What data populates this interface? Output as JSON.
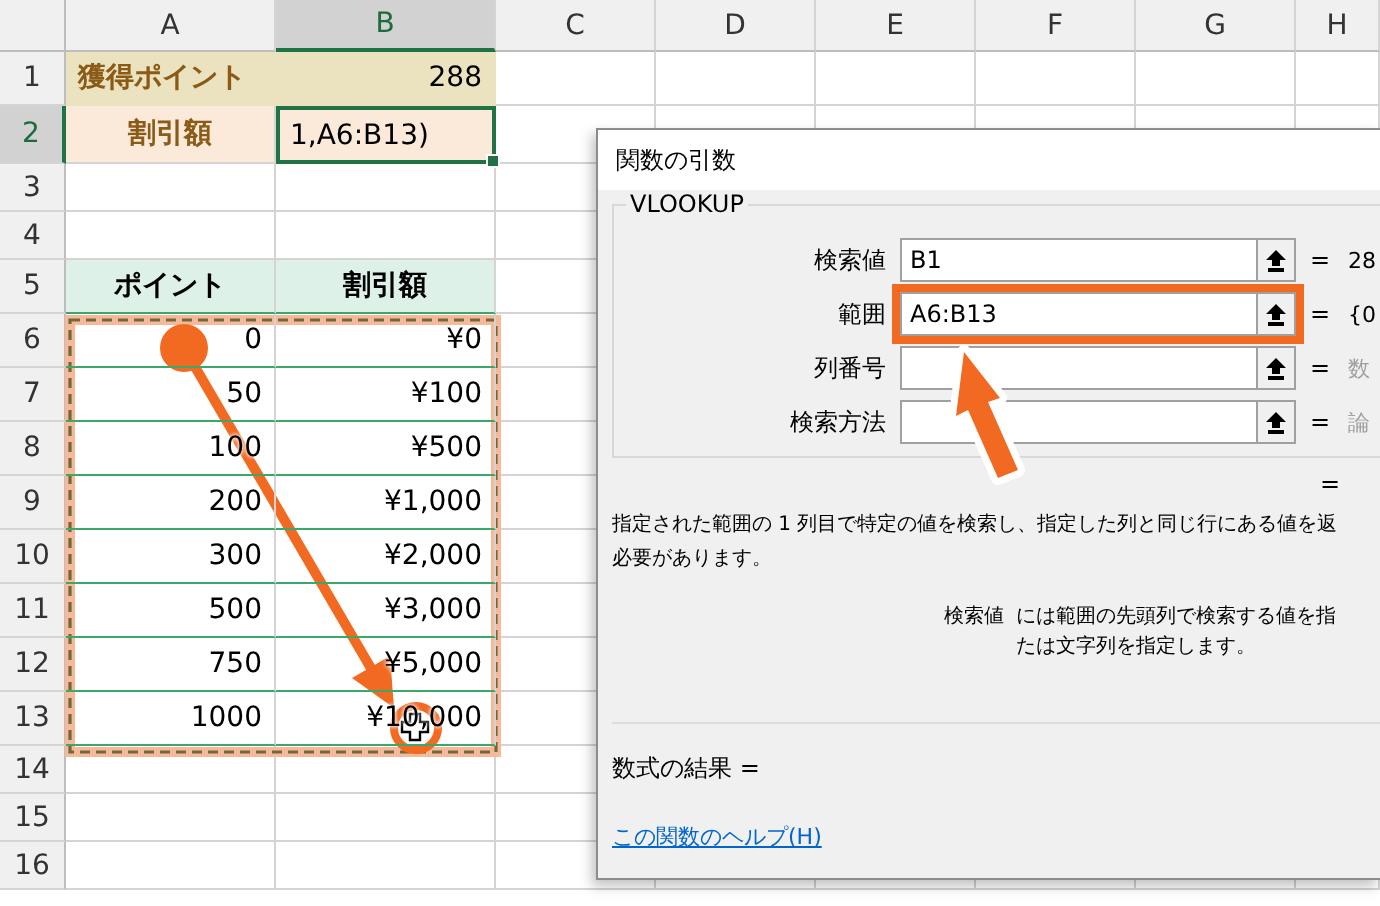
{
  "sheet": {
    "columns": [
      {
        "label": "A",
        "selected": false
      },
      {
        "label": "B",
        "selected": true
      },
      {
        "label": "C",
        "selected": false
      },
      {
        "label": "D",
        "selected": false
      },
      {
        "label": "E",
        "selected": false
      },
      {
        "label": "F",
        "selected": false
      },
      {
        "label": "G",
        "selected": false
      },
      {
        "label": "H",
        "selected": false
      }
    ],
    "rows": [
      {
        "label": "1",
        "kind": "title",
        "selected": false,
        "cells": [
          "獲得ポイント",
          "288"
        ]
      },
      {
        "label": "2",
        "kind": "input",
        "selected": true,
        "cells": [
          "割引額",
          "1,A6:B13)"
        ]
      },
      {
        "label": "3",
        "kind": "blank",
        "selected": false
      },
      {
        "label": "4",
        "kind": "blank",
        "selected": false
      },
      {
        "label": "5",
        "kind": "header",
        "selected": false,
        "cells": [
          "ポイント",
          "割引額"
        ]
      },
      {
        "label": "6",
        "kind": "data",
        "selected": false,
        "cells": [
          "0",
          "¥0"
        ]
      },
      {
        "label": "7",
        "kind": "data",
        "selected": false,
        "cells": [
          "50",
          "¥100"
        ]
      },
      {
        "label": "8",
        "kind": "data",
        "selected": false,
        "cells": [
          "100",
          "¥500"
        ]
      },
      {
        "label": "9",
        "kind": "data",
        "selected": false,
        "cells": [
          "200",
          "¥1,000"
        ]
      },
      {
        "label": "10",
        "kind": "data",
        "selected": false,
        "cells": [
          "300",
          "¥2,000"
        ]
      },
      {
        "label": "11",
        "kind": "data",
        "selected": false,
        "cells": [
          "500",
          "¥3,000"
        ]
      },
      {
        "label": "12",
        "kind": "data",
        "selected": false,
        "cells": [
          "750",
          "¥5,000"
        ]
      },
      {
        "label": "13",
        "kind": "data",
        "selected": false,
        "cells": [
          "1000",
          "¥10,000"
        ]
      },
      {
        "label": "14",
        "kind": "blank",
        "selected": false
      },
      {
        "label": "15",
        "kind": "blank",
        "selected": false
      },
      {
        "label": "16",
        "kind": "blank",
        "selected": false
      }
    ]
  },
  "dialog": {
    "title": "関数の引数",
    "function": "VLOOKUP",
    "arguments": [
      {
        "label": "検索値",
        "value": "B1",
        "equals": "=",
        "result": "28",
        "dimmed": false,
        "highlighted": false
      },
      {
        "label": "範囲",
        "value": "A6:B13",
        "equals": "=",
        "result": "{0",
        "dimmed": false,
        "highlighted": true
      },
      {
        "label": "列番号",
        "equals": "=",
        "result": "数",
        "dimmed": true,
        "highlighted": false
      },
      {
        "label": "検索方法",
        "equals": "=",
        "result": "論",
        "dimmed": true,
        "highlighted": false
      }
    ],
    "total_equals": "=",
    "description_lines": [
      "指定された範囲の 1 列目で特定の値を検索し、指定した列と同じ行にある値を返",
      "必要があります。"
    ],
    "argument_help": {
      "label": "検索値",
      "lines": [
        "には範囲の先頭列で検索する値を指",
        "たは文字列を指定します。"
      ]
    },
    "formula_result": "数式の結果 =",
    "help_link": "この関数のヘルプ(H)"
  }
}
